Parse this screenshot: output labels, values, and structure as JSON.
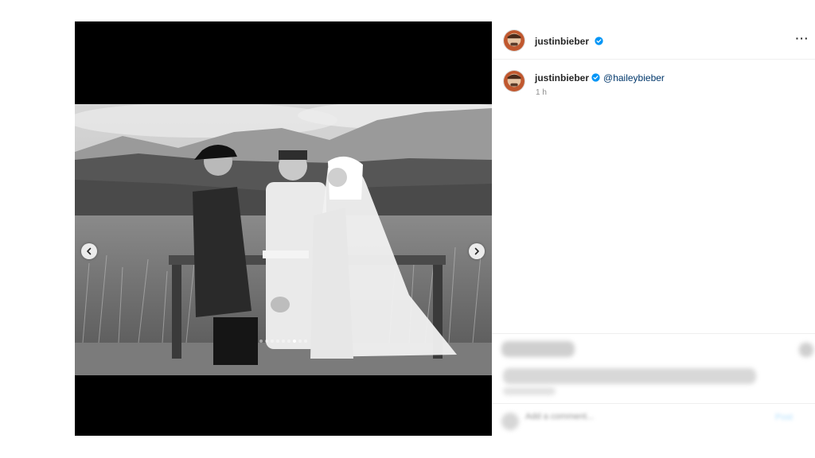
{
  "post": {
    "author": "justinbieber",
    "verified": true,
    "more_label": "···",
    "caption_author": "justinbieber",
    "caption_mention": "@haileybieber",
    "time_ago": "1 h"
  },
  "carousel": {
    "slide_count": 9,
    "active_index": 6
  },
  "comment_box": {
    "placeholder": "Add a comment...",
    "post_label": "Post"
  },
  "icons": {
    "prev": "chevron-left-icon",
    "next": "chevron-right-icon",
    "verified": "verified-badge-icon",
    "more": "more-options-icon",
    "emoji": "emoji-icon"
  },
  "colors": {
    "verified_blue": "#0095f6",
    "mention": "#00376b",
    "meta_gray": "#8e8e8e"
  }
}
